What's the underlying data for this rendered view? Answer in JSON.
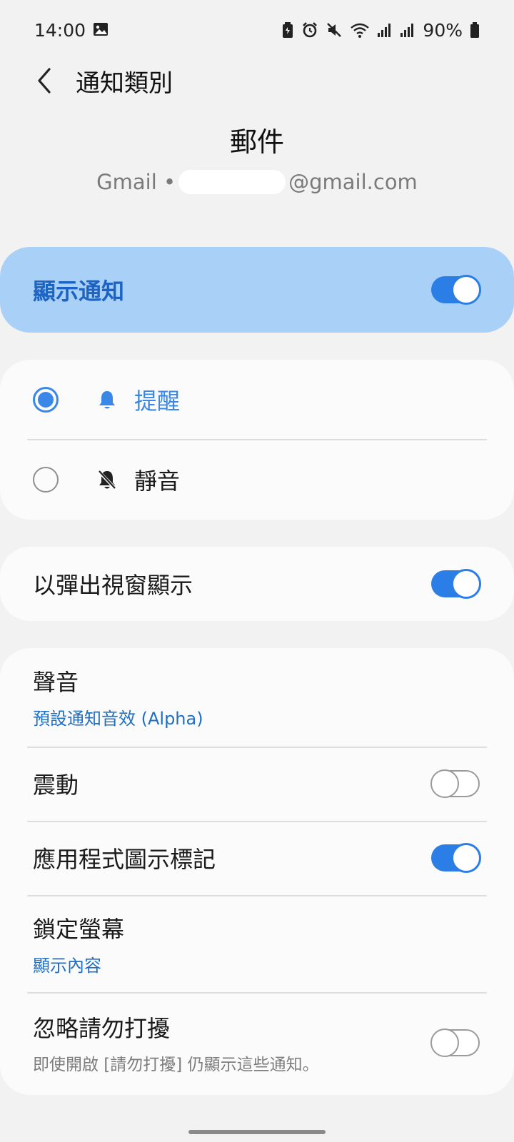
{
  "status_bar": {
    "time": "14:00",
    "battery_percent": "90%",
    "icons": [
      "image-icon",
      "battery-saver-icon",
      "alarm-icon",
      "mute-icon",
      "wifi-icon",
      "signal-icon",
      "signal-icon-2",
      "battery-icon"
    ]
  },
  "app_bar": {
    "title": "通知類別",
    "back_icon": "back-arrow-icon"
  },
  "header": {
    "title": "郵件",
    "account_prefix": "Gmail •",
    "account_suffix": "@gmail.com"
  },
  "show_notifications": {
    "label": "顯示通知",
    "enabled": true
  },
  "notification_mode": {
    "options": [
      {
        "label": "提醒",
        "icon": "bell-icon",
        "selected": true
      },
      {
        "label": "靜音",
        "icon": "bell-off-icon",
        "selected": false
      }
    ]
  },
  "popup": {
    "label": "以彈出視窗顯示",
    "enabled": true
  },
  "settings": {
    "sound": {
      "label": "聲音",
      "value": "預設通知音效 (Alpha)"
    },
    "vibration": {
      "label": "震動",
      "enabled": false
    },
    "badge": {
      "label": "應用程式圖示標記",
      "enabled": true
    },
    "lock_screen": {
      "label": "鎖定螢幕",
      "value": "顯示內容"
    },
    "dnd": {
      "label": "忽略請勿打擾",
      "description": "即使開啟 [請勿打擾] 仍顯示這些通知。",
      "enabled": false
    }
  },
  "colors": {
    "accent": "#2a7ee6",
    "master_card_bg": "#a9d1f7",
    "master_label": "#1c63c4",
    "background": "#f2f2f2"
  }
}
